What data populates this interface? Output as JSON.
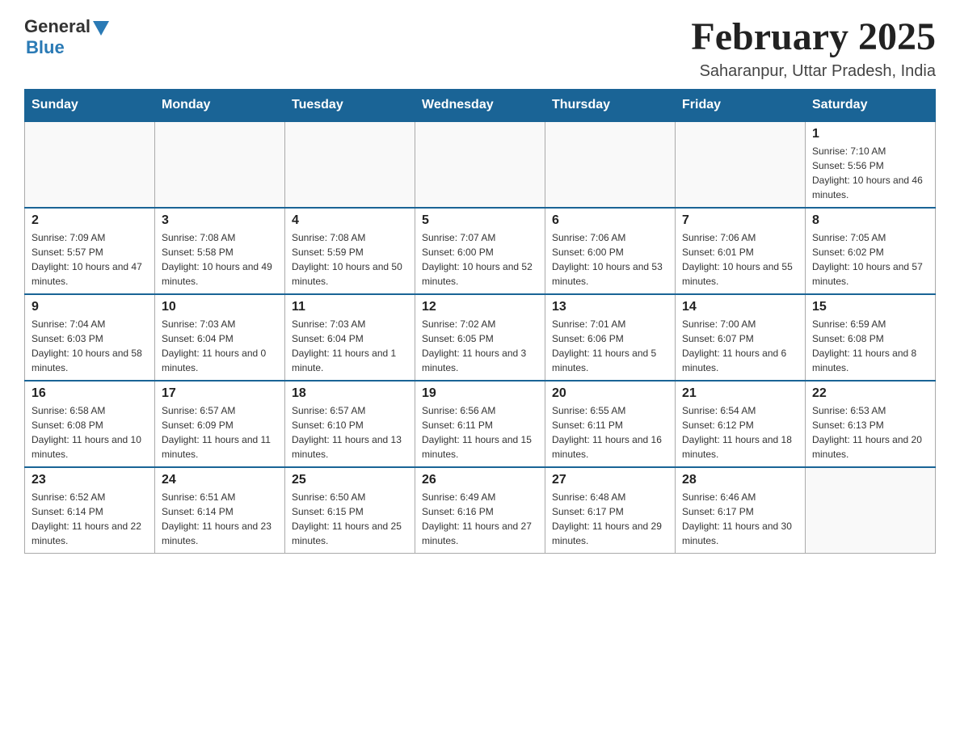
{
  "logo": {
    "general": "General",
    "blue": "Blue"
  },
  "title": "February 2025",
  "location": "Saharanpur, Uttar Pradesh, India",
  "days_of_week": [
    "Sunday",
    "Monday",
    "Tuesday",
    "Wednesday",
    "Thursday",
    "Friday",
    "Saturday"
  ],
  "weeks": [
    [
      {
        "day": "",
        "info": ""
      },
      {
        "day": "",
        "info": ""
      },
      {
        "day": "",
        "info": ""
      },
      {
        "day": "",
        "info": ""
      },
      {
        "day": "",
        "info": ""
      },
      {
        "day": "",
        "info": ""
      },
      {
        "day": "1",
        "info": "Sunrise: 7:10 AM\nSunset: 5:56 PM\nDaylight: 10 hours and 46 minutes."
      }
    ],
    [
      {
        "day": "2",
        "info": "Sunrise: 7:09 AM\nSunset: 5:57 PM\nDaylight: 10 hours and 47 minutes."
      },
      {
        "day": "3",
        "info": "Sunrise: 7:08 AM\nSunset: 5:58 PM\nDaylight: 10 hours and 49 minutes."
      },
      {
        "day": "4",
        "info": "Sunrise: 7:08 AM\nSunset: 5:59 PM\nDaylight: 10 hours and 50 minutes."
      },
      {
        "day": "5",
        "info": "Sunrise: 7:07 AM\nSunset: 6:00 PM\nDaylight: 10 hours and 52 minutes."
      },
      {
        "day": "6",
        "info": "Sunrise: 7:06 AM\nSunset: 6:00 PM\nDaylight: 10 hours and 53 minutes."
      },
      {
        "day": "7",
        "info": "Sunrise: 7:06 AM\nSunset: 6:01 PM\nDaylight: 10 hours and 55 minutes."
      },
      {
        "day": "8",
        "info": "Sunrise: 7:05 AM\nSunset: 6:02 PM\nDaylight: 10 hours and 57 minutes."
      }
    ],
    [
      {
        "day": "9",
        "info": "Sunrise: 7:04 AM\nSunset: 6:03 PM\nDaylight: 10 hours and 58 minutes."
      },
      {
        "day": "10",
        "info": "Sunrise: 7:03 AM\nSunset: 6:04 PM\nDaylight: 11 hours and 0 minutes."
      },
      {
        "day": "11",
        "info": "Sunrise: 7:03 AM\nSunset: 6:04 PM\nDaylight: 11 hours and 1 minute."
      },
      {
        "day": "12",
        "info": "Sunrise: 7:02 AM\nSunset: 6:05 PM\nDaylight: 11 hours and 3 minutes."
      },
      {
        "day": "13",
        "info": "Sunrise: 7:01 AM\nSunset: 6:06 PM\nDaylight: 11 hours and 5 minutes."
      },
      {
        "day": "14",
        "info": "Sunrise: 7:00 AM\nSunset: 6:07 PM\nDaylight: 11 hours and 6 minutes."
      },
      {
        "day": "15",
        "info": "Sunrise: 6:59 AM\nSunset: 6:08 PM\nDaylight: 11 hours and 8 minutes."
      }
    ],
    [
      {
        "day": "16",
        "info": "Sunrise: 6:58 AM\nSunset: 6:08 PM\nDaylight: 11 hours and 10 minutes."
      },
      {
        "day": "17",
        "info": "Sunrise: 6:57 AM\nSunset: 6:09 PM\nDaylight: 11 hours and 11 minutes."
      },
      {
        "day": "18",
        "info": "Sunrise: 6:57 AM\nSunset: 6:10 PM\nDaylight: 11 hours and 13 minutes."
      },
      {
        "day": "19",
        "info": "Sunrise: 6:56 AM\nSunset: 6:11 PM\nDaylight: 11 hours and 15 minutes."
      },
      {
        "day": "20",
        "info": "Sunrise: 6:55 AM\nSunset: 6:11 PM\nDaylight: 11 hours and 16 minutes."
      },
      {
        "day": "21",
        "info": "Sunrise: 6:54 AM\nSunset: 6:12 PM\nDaylight: 11 hours and 18 minutes."
      },
      {
        "day": "22",
        "info": "Sunrise: 6:53 AM\nSunset: 6:13 PM\nDaylight: 11 hours and 20 minutes."
      }
    ],
    [
      {
        "day": "23",
        "info": "Sunrise: 6:52 AM\nSunset: 6:14 PM\nDaylight: 11 hours and 22 minutes."
      },
      {
        "day": "24",
        "info": "Sunrise: 6:51 AM\nSunset: 6:14 PM\nDaylight: 11 hours and 23 minutes."
      },
      {
        "day": "25",
        "info": "Sunrise: 6:50 AM\nSunset: 6:15 PM\nDaylight: 11 hours and 25 minutes."
      },
      {
        "day": "26",
        "info": "Sunrise: 6:49 AM\nSunset: 6:16 PM\nDaylight: 11 hours and 27 minutes."
      },
      {
        "day": "27",
        "info": "Sunrise: 6:48 AM\nSunset: 6:17 PM\nDaylight: 11 hours and 29 minutes."
      },
      {
        "day": "28",
        "info": "Sunrise: 6:46 AM\nSunset: 6:17 PM\nDaylight: 11 hours and 30 minutes."
      },
      {
        "day": "",
        "info": ""
      }
    ]
  ]
}
